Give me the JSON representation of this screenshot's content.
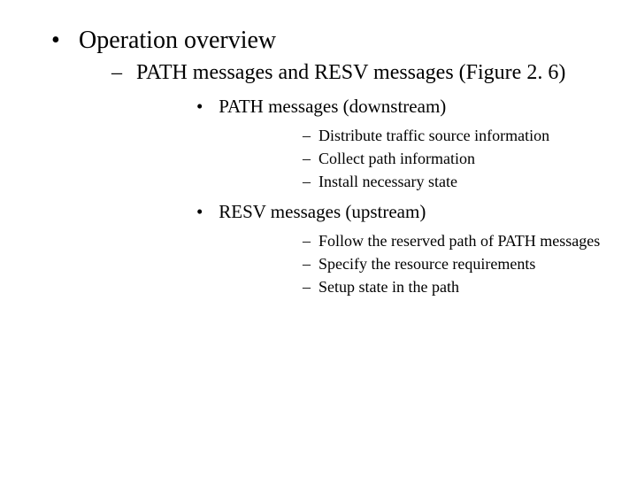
{
  "outline": {
    "l1": "Operation overview",
    "l2": "PATH messages and RESV messages (Figure 2. 6)",
    "l3a": "PATH messages (downstream)",
    "l4a": "Distribute traffic source information",
    "l4b": "Collect path information",
    "l4c": "Install necessary state",
    "l3b": "RESV messages (upstream)",
    "l4d": "Follow the reserved path of PATH messages",
    "l4e": "Specify the resource requirements",
    "l4f": "Setup state in the path"
  }
}
